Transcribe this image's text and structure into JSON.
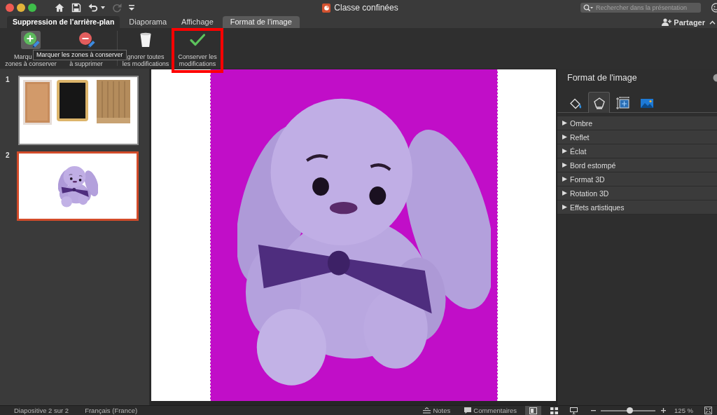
{
  "window": {
    "title": "Classe confinées",
    "search": {
      "placeholder": "Rechercher dans la présentation"
    }
  },
  "quick_access": [
    {
      "kind": "home",
      "disabled": false
    },
    {
      "kind": "save",
      "disabled": false
    },
    {
      "kind": "undo",
      "disabled": false,
      "dropdown": true
    },
    {
      "kind": "redo",
      "disabled": true
    },
    {
      "kind": "customize",
      "disabled": false
    }
  ],
  "ribbon_tabs": [
    {
      "label": "Suppression de l’arrière-plan",
      "selected": true,
      "contextual": false
    },
    {
      "label": "Diaporama",
      "selected": false,
      "contextual": false
    },
    {
      "label": "Affichage",
      "selected": false,
      "contextual": false
    },
    {
      "label": "Format de l’image",
      "selected": false,
      "contextual": true
    }
  ],
  "share": {
    "label": "Partager"
  },
  "ribbon": {
    "buttons": [
      {
        "kind": "mark_keep",
        "line_1": "Marqu",
        "line_2": "zones à conserver",
        "hovered": true,
        "annotated": false
      },
      {
        "kind": "mark_remove",
        "line_2": "à supprimer",
        "hovered": false,
        "annotated": false
      },
      {
        "kind": "discard",
        "line_1": "gnorer toutes",
        "line_2": "les modifications",
        "hovered": false,
        "annotated": false
      },
      {
        "kind": "keep",
        "line_1": "Conserver les",
        "line_2": "modifications",
        "hovered": false,
        "annotated": true
      }
    ],
    "tooltip": "Marquer les zones à conserver"
  },
  "slides": [
    {
      "number": "1",
      "selected": false,
      "kind": "objects"
    },
    {
      "number": "2",
      "selected": true,
      "kind": "bunny"
    }
  ],
  "format_panel": {
    "title": "Format de l'image",
    "tabs": [
      {
        "kind": "fill",
        "selected": false
      },
      {
        "kind": "effects",
        "selected": true
      },
      {
        "kind": "layout",
        "selected": false
      },
      {
        "kind": "picture",
        "selected": false
      }
    ],
    "sections": [
      {
        "label": "Ombre",
        "expanded": false
      },
      {
        "label": "Reflet",
        "expanded": false
      },
      {
        "label": "Éclat",
        "expanded": false
      },
      {
        "label": "Bord estompé",
        "expanded": false
      },
      {
        "label": "Format 3D",
        "expanded": false
      },
      {
        "label": "Rotation 3D",
        "expanded": false
      },
      {
        "label": "Effets artistiques",
        "expanded": false
      }
    ]
  },
  "status_bar": {
    "slide_info": "Diapositive 2 sur 2",
    "language": "Français (France)",
    "notes": "Notes",
    "comments": "Commentaires",
    "views": [
      {
        "kind": "normal",
        "selected": true
      },
      {
        "kind": "sorter",
        "selected": false
      },
      {
        "kind": "presenter",
        "selected": false
      }
    ],
    "zoom": {
      "level": 0.54,
      "reading": "125 %"
    }
  }
}
